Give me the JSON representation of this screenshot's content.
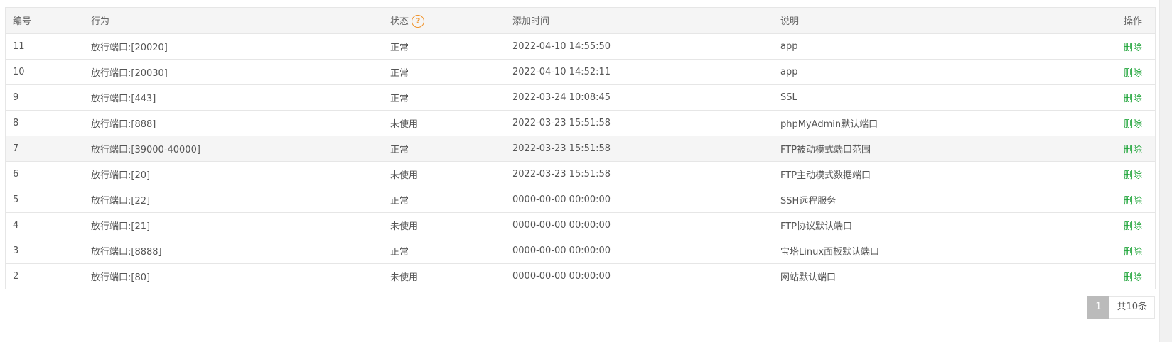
{
  "table": {
    "headers": {
      "id": "编号",
      "action": "行为",
      "status": "状态",
      "time": "添加时间",
      "desc": "说明",
      "op": "操作"
    },
    "help_icon": "question-circle-icon",
    "rows": [
      {
        "id": "11",
        "action": "放行端口:[20020]",
        "status": "正常",
        "time": "2022-04-10 14:55:50",
        "desc": "app",
        "op": "删除"
      },
      {
        "id": "10",
        "action": "放行端口:[20030]",
        "status": "正常",
        "time": "2022-04-10 14:52:11",
        "desc": "app",
        "op": "删除"
      },
      {
        "id": "9",
        "action": "放行端口:[443]",
        "status": "正常",
        "time": "2022-03-24 10:08:45",
        "desc": "SSL",
        "op": "删除"
      },
      {
        "id": "8",
        "action": "放行端口:[888]",
        "status": "未使用",
        "time": "2022-03-23 15:51:58",
        "desc": "phpMyAdmin默认端口",
        "op": "删除"
      },
      {
        "id": "7",
        "action": "放行端口:[39000-40000]",
        "status": "正常",
        "time": "2022-03-23 15:51:58",
        "desc": "FTP被动模式端口范围",
        "op": "删除"
      },
      {
        "id": "6",
        "action": "放行端口:[20]",
        "status": "未使用",
        "time": "2022-03-23 15:51:58",
        "desc": "FTP主动模式数据端口",
        "op": "删除"
      },
      {
        "id": "5",
        "action": "放行端口:[22]",
        "status": "正常",
        "time": "0000-00-00 00:00:00",
        "desc": "SSH远程服务",
        "op": "删除"
      },
      {
        "id": "4",
        "action": "放行端口:[21]",
        "status": "未使用",
        "time": "0000-00-00 00:00:00",
        "desc": "FTP协议默认端口",
        "op": "删除"
      },
      {
        "id": "3",
        "action": "放行端口:[8888]",
        "status": "正常",
        "time": "0000-00-00 00:00:00",
        "desc": "宝塔Linux面板默认端口",
        "op": "删除"
      },
      {
        "id": "2",
        "action": "放行端口:[80]",
        "status": "未使用",
        "time": "0000-00-00 00:00:00",
        "desc": "网站默认端口",
        "op": "删除"
      }
    ]
  },
  "pagination": {
    "current_page": "1",
    "total_label": "共10条"
  },
  "colors": {
    "delete_link": "#20a53a",
    "help_icon": "#f0932b",
    "header_bg": "#f5f5f5",
    "active_page_bg": "#bbbbbb"
  }
}
